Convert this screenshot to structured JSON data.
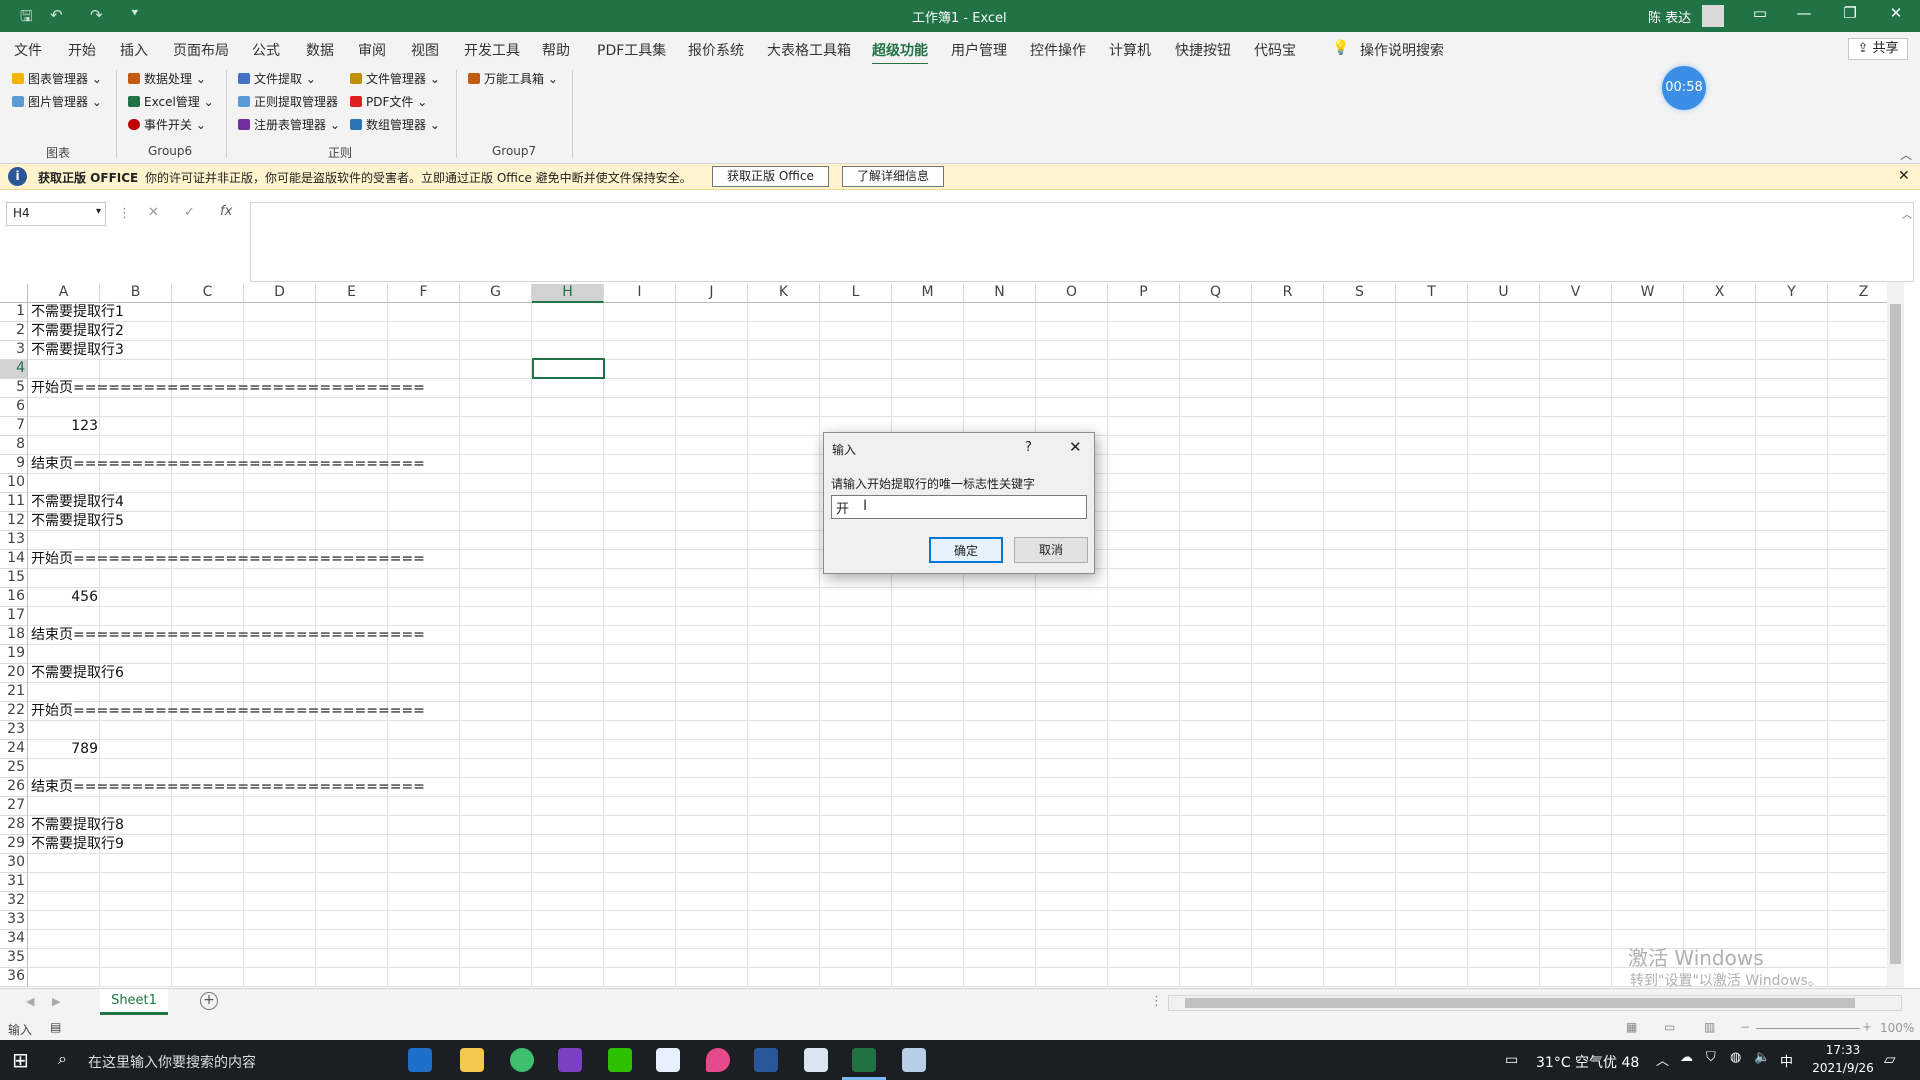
{
  "titlebar": {
    "title": "工作簿1  -  Excel",
    "user": "陈 表达"
  },
  "tabs": [
    "文件",
    "开始",
    "插入",
    "页面布局",
    "公式",
    "数据",
    "审阅",
    "视图",
    "开发工具",
    "帮助",
    "PDF工具集",
    "报价系统",
    "大表格工具箱",
    "超级功能",
    "用户管理",
    "控件操作",
    "计算机",
    "快捷按钮",
    "代码宝"
  ],
  "active_tab": "超级功能",
  "tell_me": "操作说明搜索",
  "share": "共享",
  "timer": "00:58",
  "ribbon": {
    "g1": {
      "items": [
        "图表管理器",
        "图片管理器"
      ],
      "label": "图表"
    },
    "g2": {
      "items": [
        "数据处理",
        "Excel管理",
        "事件开关"
      ],
      "label": "Group6"
    },
    "g3": {
      "items": [
        "文件提取",
        "正则提取管理器",
        "注册表管理器",
        "文件管理器",
        "PDF文件",
        "数组管理器"
      ],
      "label": "正则"
    },
    "g4": {
      "items": [
        "万能工具箱"
      ],
      "label": "Group7"
    }
  },
  "msgbar": {
    "title": "获取正版 OFFICE",
    "text": "你的许可证并非正版，你可能是盗版软件的受害者。立即通过正版 Office 避免中断并使文件保持安全。",
    "btn1": "获取正版 Office",
    "btn2": "了解详细信息"
  },
  "namebox": "H4",
  "columns": [
    "A",
    "B",
    "C",
    "D",
    "E",
    "F",
    "G",
    "H",
    "I",
    "J",
    "K",
    "L",
    "M",
    "N",
    "O",
    "P",
    "Q",
    "R",
    "S",
    "T",
    "U",
    "V",
    "W",
    "X",
    "Y",
    "Z"
  ],
  "rows": [
    "1",
    "2",
    "3",
    "4",
    "5",
    "6",
    "7",
    "8",
    "9",
    "10",
    "11",
    "12",
    "13",
    "14",
    "15",
    "16",
    "17",
    "18",
    "19",
    "20",
    "21",
    "22",
    "23",
    "24",
    "25",
    "26",
    "27",
    "28",
    "29",
    "30",
    "31",
    "32",
    "33",
    "34",
    "35",
    "36"
  ],
  "cells": [
    {
      "row": 1,
      "text": "不需要提取行1",
      "align": "left"
    },
    {
      "row": 2,
      "text": "不需要提取行2",
      "align": "left"
    },
    {
      "row": 3,
      "text": "不需要提取行3",
      "align": "left"
    },
    {
      "row": 5,
      "text": "开始页==============================",
      "align": "left"
    },
    {
      "row": 7,
      "text": "123",
      "align": "right"
    },
    {
      "row": 9,
      "text": "结束页==============================",
      "align": "left"
    },
    {
      "row": 11,
      "text": "不需要提取行4",
      "align": "left"
    },
    {
      "row": 12,
      "text": "不需要提取行5",
      "align": "left"
    },
    {
      "row": 14,
      "text": "开始页==============================",
      "align": "left"
    },
    {
      "row": 16,
      "text": "456",
      "align": "right"
    },
    {
      "row": 18,
      "text": "结束页==============================",
      "align": "left"
    },
    {
      "row": 20,
      "text": "不需要提取行6",
      "align": "left"
    },
    {
      "row": 22,
      "text": "开始页==============================",
      "align": "left"
    },
    {
      "row": 24,
      "text": "789",
      "align": "right"
    },
    {
      "row": 26,
      "text": "结束页==============================",
      "align": "left"
    },
    {
      "row": 28,
      "text": "不需要提取行8",
      "align": "left"
    },
    {
      "row": 29,
      "text": "不需要提取行9",
      "align": "left"
    }
  ],
  "dialog": {
    "title": "输入",
    "help": "?",
    "prompt": "请输入开始提取行的唯一标志性关键字",
    "value": "开",
    "ok": "确定",
    "cancel": "取消"
  },
  "sheet_tab": "Sheet1",
  "watermark": {
    "line1": "激活 Windows",
    "line2": "转到\"设置\"以激活 Windows。"
  },
  "status": {
    "mode": "输入",
    "zoom": "100%"
  },
  "taskbar": {
    "search": "在这里输入你要搜索的内容",
    "weather": "31°C 空气优 48",
    "ime": "中",
    "time": "17:33",
    "date": "2021/9/26"
  },
  "colors": {
    "excel_green": "#217346",
    "msg_yellow": "#fff4ce",
    "timer_blue": "#3a8ee6"
  }
}
